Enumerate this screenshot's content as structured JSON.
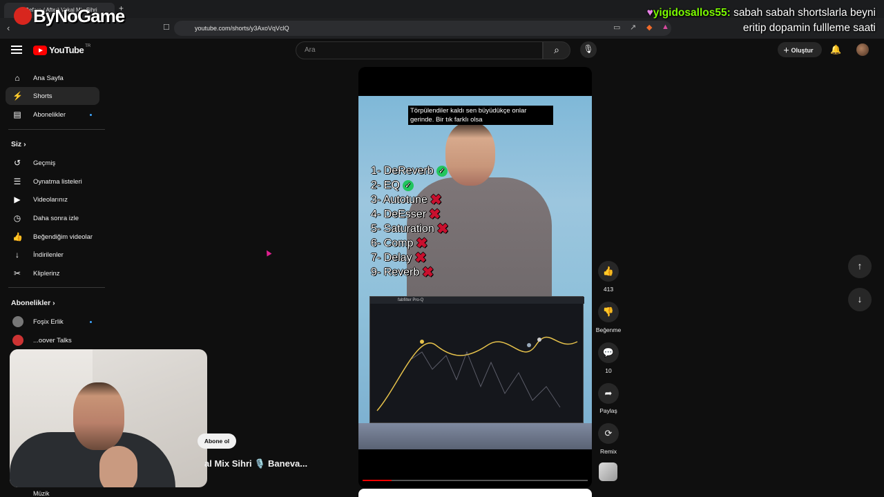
{
  "browser": {
    "tab_title": "(Before / After) Vokal Mix Sihri",
    "url": "youtube.com/shorts/y3AxoVqVclQ"
  },
  "overlay": {
    "logo_text": "ByNoGame",
    "chat_user": "yigidosallos55:",
    "chat_message_line1": "sabah sabah shortslarla beyni",
    "chat_message_line2": "eritip dopamin fullleme saati"
  },
  "header": {
    "logo": "YouTube",
    "country": "TR",
    "search_placeholder": "Ara",
    "create_label": "Oluştur"
  },
  "sidebar": {
    "primary": [
      {
        "label": "Ana Sayfa",
        "icon": "home-icon"
      },
      {
        "label": "Shorts",
        "icon": "shorts-icon"
      },
      {
        "label": "Abonelikler",
        "icon": "subscriptions-icon"
      }
    ],
    "you_heading": "Siz",
    "you_items": [
      {
        "label": "Geçmiş",
        "icon": "history-icon"
      },
      {
        "label": "Oynatma listeleri",
        "icon": "playlist-icon"
      },
      {
        "label": "Videolarınız",
        "icon": "your-videos-icon"
      },
      {
        "label": "Daha sonra izle",
        "icon": "watch-later-icon"
      },
      {
        "label": "Beğendiğim videolar",
        "icon": "liked-icon"
      },
      {
        "label": "İndirilenler",
        "icon": "download-icon"
      },
      {
        "label": "Kliplerinz",
        "icon": "clips-icon"
      }
    ],
    "subs_heading": "Abonelikler",
    "channels": [
      {
        "label": "Foşix Erlik"
      },
      {
        "label": "...oover Talks"
      }
    ],
    "bottom_item": "Müzik"
  },
  "short": {
    "caption": "Törpülendiler kaldı sen büyüdükçe onlar gerinde. Bir tık farklı olsa",
    "steps": [
      {
        "label": "1- DeReverb",
        "status": "check"
      },
      {
        "label": "2- EQ",
        "status": "check"
      },
      {
        "label": "3- Autotune",
        "status": "cross"
      },
      {
        "label": "4- DeEsser",
        "status": "cross"
      },
      {
        "label": "5- Saturation",
        "status": "cross"
      },
      {
        "label": "6- Comp",
        "status": "cross"
      },
      {
        "label": "7- Delay",
        "status": "cross"
      },
      {
        "label": "9- Reverb",
        "status": "cross"
      }
    ],
    "plugin_name": "fabfilter Pro-Q",
    "progress": 0.13,
    "subscribe_label": "Abone ol",
    "title": "al Mix Sihri 🎙️ Baneva..."
  },
  "actions": {
    "like_count": "413",
    "dislike_label": "Beğenme",
    "comment_count": "10",
    "share_label": "Paylaş",
    "remix_label": "Remix"
  },
  "colors": {
    "accent": "#ff0000",
    "background": "#0f0f0f",
    "check": "#22c55e",
    "cross": "#c8102e",
    "chat_user": "#7CFC00"
  }
}
